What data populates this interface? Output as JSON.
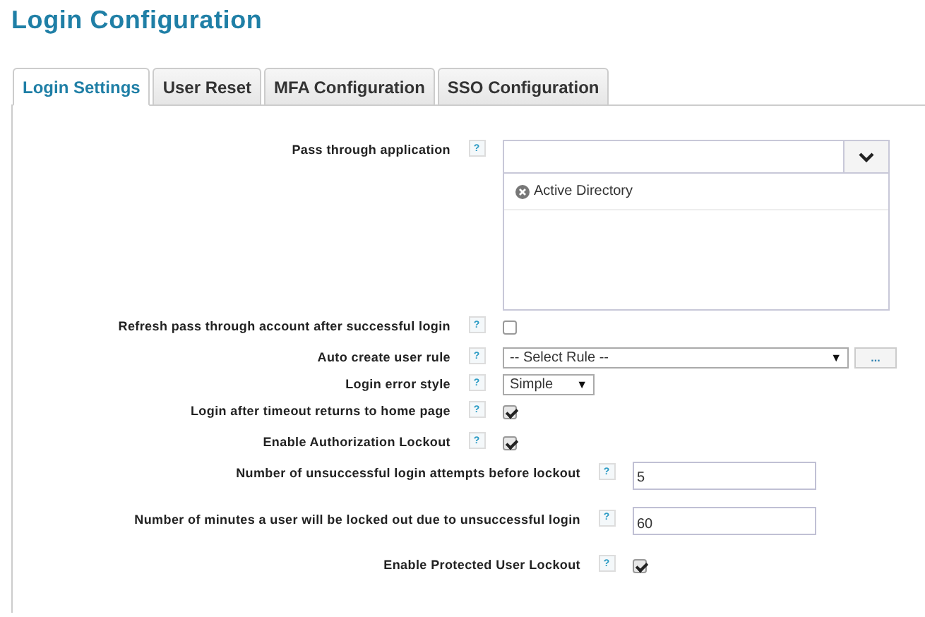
{
  "title": "Login Configuration",
  "tabs": [
    {
      "label": "Login Settings",
      "selected": true
    },
    {
      "label": "User Reset",
      "selected": false
    },
    {
      "label": "MFA Configuration",
      "selected": false
    },
    {
      "label": "SSO Configuration",
      "selected": false
    }
  ],
  "sections": [
    {
      "fields": [
        {
          "kind": "multiselect",
          "label": "Pass through application",
          "help": "?",
          "items": [
            "Active Directory"
          ]
        },
        {
          "kind": "checkbox",
          "label": "Refresh pass through account after successful login",
          "help": "?",
          "checked": false
        },
        {
          "kind": "select",
          "label": "Auto create user rule",
          "help": "?",
          "value": "-- Select Rule --",
          "caret": "▼",
          "wide": true,
          "more": "..."
        },
        {
          "kind": "select",
          "label": "Login error style",
          "help": "?",
          "value": "Simple",
          "caret": "▼",
          "wide": false
        },
        {
          "kind": "checkbox",
          "label": "Login after timeout returns to home page",
          "help": "?",
          "checked": true
        },
        {
          "kind": "checkbox",
          "label": "Enable Authorization Lockout",
          "help": "?",
          "checked": true
        }
      ]
    },
    {
      "fields": [
        {
          "kind": "text",
          "label": "Number of unsuccessful login attempts before lockout",
          "help": "?",
          "value": "5"
        },
        {
          "kind": "text",
          "label": "Number of minutes a user will be locked out due to unsuccessful login",
          "help": "?",
          "value": "60"
        },
        {
          "kind": "checkbox",
          "label": "Enable Protected User Lockout",
          "help": "?",
          "checked": true
        }
      ]
    }
  ]
}
